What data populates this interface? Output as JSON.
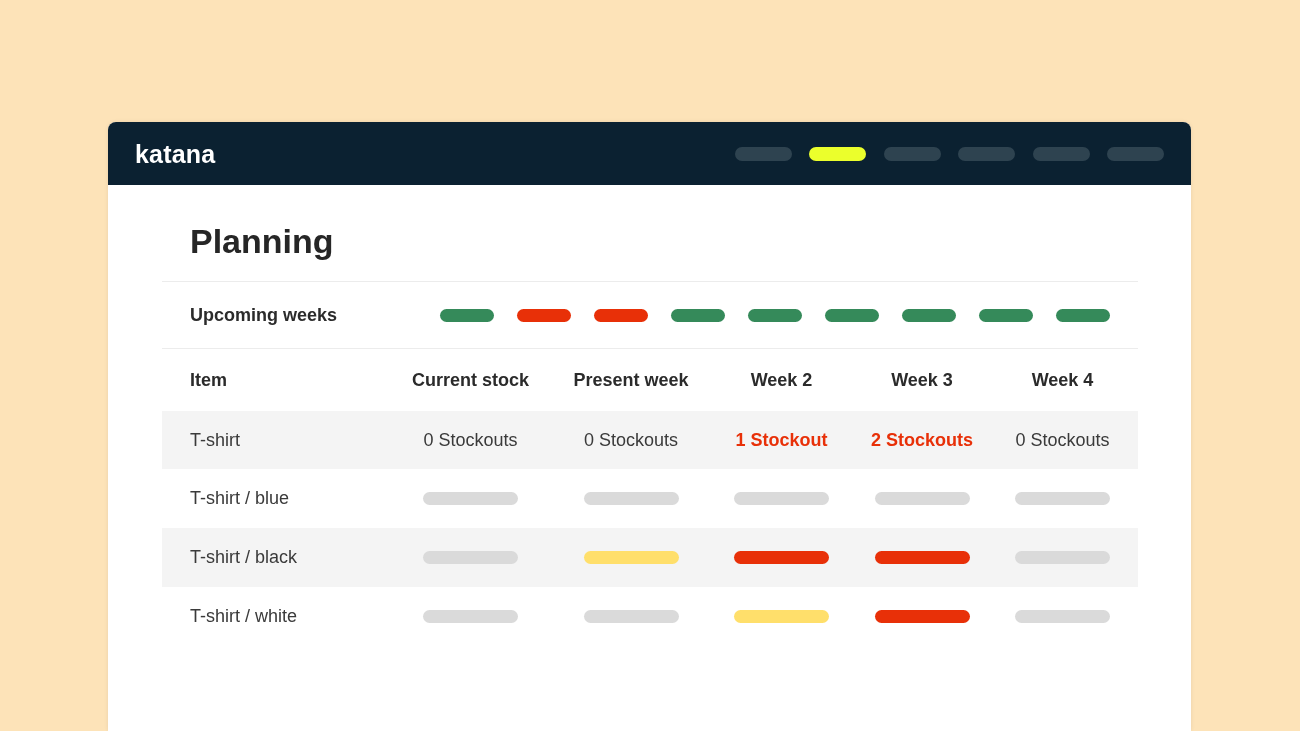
{
  "header": {
    "logo": "katana",
    "nav": [
      {
        "selected": false
      },
      {
        "selected": true
      },
      {
        "selected": false
      },
      {
        "selected": false
      },
      {
        "selected": false
      },
      {
        "selected": false
      }
    ]
  },
  "page": {
    "title": "Planning"
  },
  "upcoming_weeks": {
    "label": "Upcoming weeks",
    "weeks": [
      {
        "color": "#358a5a"
      },
      {
        "color": "#e83008"
      },
      {
        "color": "#e83008"
      },
      {
        "color": "#358a5a"
      },
      {
        "color": "#358a5a"
      },
      {
        "color": "#358a5a"
      },
      {
        "color": "#358a5a"
      },
      {
        "color": "#358a5a"
      },
      {
        "color": "#358a5a"
      }
    ]
  },
  "table": {
    "columns": [
      "Item",
      "Current stock",
      "Present week",
      "Week 2",
      "Week 3",
      "Week 4"
    ],
    "rows": [
      {
        "cells": [
          {
            "kind": "item",
            "text": "T-shirt"
          },
          {
            "kind": "text",
            "text": "0 Stockouts",
            "alert": false
          },
          {
            "kind": "text",
            "text": "0 Stockouts",
            "alert": false
          },
          {
            "kind": "text",
            "text": "1 Stockout",
            "alert": true
          },
          {
            "kind": "text",
            "text": "2 Stockouts",
            "alert": true
          },
          {
            "kind": "text",
            "text": "0 Stockouts",
            "alert": false
          }
        ]
      },
      {
        "cells": [
          {
            "kind": "item",
            "text": "T-shirt / blue"
          },
          {
            "kind": "bar",
            "color": "#dadada"
          },
          {
            "kind": "bar",
            "color": "#dadada"
          },
          {
            "kind": "bar",
            "color": "#dadada"
          },
          {
            "kind": "bar",
            "color": "#dadada"
          },
          {
            "kind": "bar",
            "color": "#dadada"
          }
        ]
      },
      {
        "cells": [
          {
            "kind": "item",
            "text": "T-shirt / black"
          },
          {
            "kind": "bar",
            "color": "#dadada"
          },
          {
            "kind": "bar",
            "color": "#ffdf6b"
          },
          {
            "kind": "bar",
            "color": "#e83008"
          },
          {
            "kind": "bar",
            "color": "#e83008"
          },
          {
            "kind": "bar",
            "color": "#dadada"
          }
        ]
      },
      {
        "cells": [
          {
            "kind": "item",
            "text": "T-shirt / white"
          },
          {
            "kind": "bar",
            "color": "#dadada"
          },
          {
            "kind": "bar",
            "color": "#dadada"
          },
          {
            "kind": "bar",
            "color": "#ffdf6b"
          },
          {
            "kind": "bar",
            "color": "#e83008"
          },
          {
            "kind": "bar",
            "color": "#dadada"
          }
        ]
      }
    ]
  }
}
